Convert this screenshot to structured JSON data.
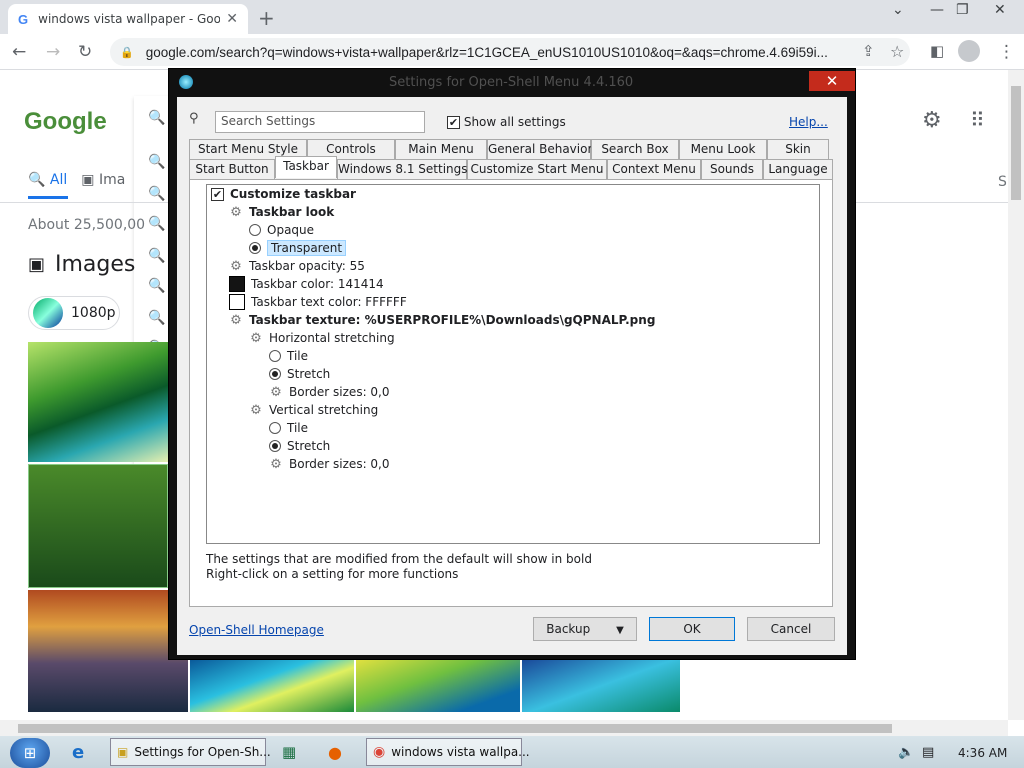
{
  "browser": {
    "tab_title": "windows vista wallpaper - Googl",
    "tab_favicon": "G",
    "url": "google.com/search?q=windows+vista+wallpaper&rlz=1C1GCEA_enUS1010US1010&oq=&aqs=chrome.4.69i59i..."
  },
  "google": {
    "logo": "Google",
    "tab_all": "All",
    "tab_images": "Ima",
    "about": "About 25,500,00",
    "images_heading": "Images",
    "chip_label": "1080p",
    "right_letter": "S"
  },
  "dialog": {
    "title": "Settings for Open-Shell Menu 4.4.160",
    "search_placeholder": "Search Settings",
    "show_all": "Show all settings",
    "help": "Help...",
    "tabs_row1": [
      "Start Menu Style",
      "Controls",
      "Main Menu",
      "General Behavior",
      "Search Box",
      "Menu Look",
      "Skin"
    ],
    "tabs_row2": [
      "Start Button",
      "Taskbar",
      "Windows 8.1 Settings",
      "Customize Start Menu",
      "Context Menu",
      "Sounds",
      "Language"
    ],
    "selected_tab": "Taskbar",
    "tree": [
      {
        "label": "Customize taskbar",
        "bold": true
      },
      {
        "label": "Taskbar look",
        "bold": true
      },
      {
        "label": "Opaque"
      },
      {
        "label": "Transparent"
      },
      {
        "label": "Taskbar opacity: 55"
      },
      {
        "label": "Taskbar color: 141414"
      },
      {
        "label": "Taskbar text color: FFFFFF"
      },
      {
        "label": "Taskbar texture: %USERPROFILE%\\Downloads\\gQPNALP.png",
        "bold": true
      },
      {
        "label": "Horizontal stretching"
      },
      {
        "label": "Tile"
      },
      {
        "label": "Stretch"
      },
      {
        "label": "Border sizes: 0,0"
      },
      {
        "label": "Vertical stretching"
      },
      {
        "label": "Tile"
      },
      {
        "label": "Stretch"
      },
      {
        "label": "Border sizes: 0,0"
      }
    ],
    "note1": "The settings that are modified from the default will show in bold",
    "note2": "Right-click on a setting for more functions",
    "homepage": "Open-Shell Homepage",
    "backup": "Backup",
    "ok": "OK",
    "cancel": "Cancel",
    "taskbar_color": "#141414",
    "taskbar_text_color": "#FFFFFF"
  },
  "taskbar": {
    "item_settings": "Settings for Open-Sh...",
    "item_chrome": "windows vista wallpa...",
    "clock": "4:36 AM"
  }
}
